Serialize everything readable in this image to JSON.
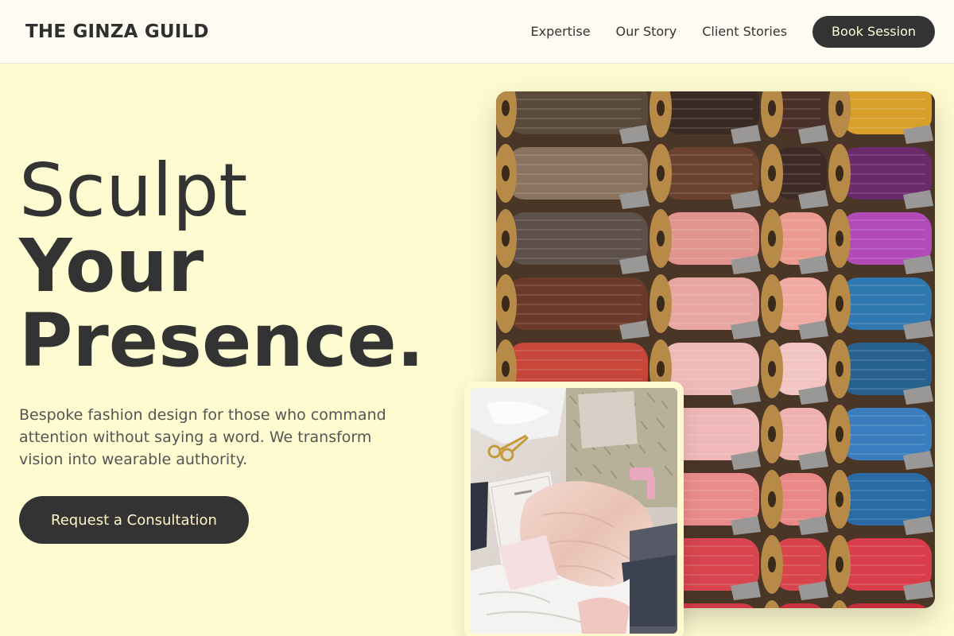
{
  "header": {
    "logo": "THE GINZA GUILD",
    "nav": [
      {
        "label": "Expertise"
      },
      {
        "label": "Our Story"
      },
      {
        "label": "Client Stories"
      }
    ],
    "cta_label": "Book Session"
  },
  "hero": {
    "title_line1": "Sculpt",
    "title_line2": "Your",
    "title_line3": "Presence.",
    "description": "Bespoke fashion design for those who command attention without saying a word. We transform vision into wearable authority.",
    "cta_label": "Request a Consultation"
  },
  "images": {
    "main": "thread-spools-photo",
    "secondary": "fabric-flatlay-photo"
  },
  "colors": {
    "background": "#fffbd1",
    "header_bg": "#fffdf3",
    "primary_dark": "#333333",
    "button_text": "#fff6c8"
  }
}
